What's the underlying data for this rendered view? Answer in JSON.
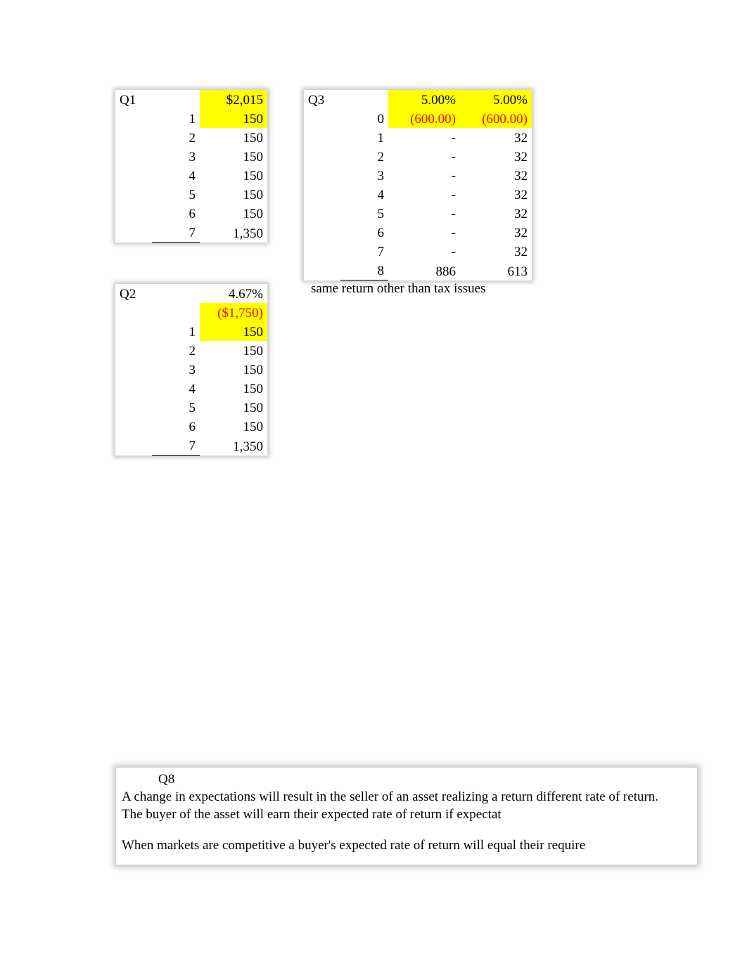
{
  "q1": {
    "label": "Q1",
    "rows": [
      {
        "idx": "",
        "val": "$2,015",
        "hl": true
      },
      {
        "idx": "1",
        "val": "150",
        "hl": true
      },
      {
        "idx": "2",
        "val": "150"
      },
      {
        "idx": "3",
        "val": "150"
      },
      {
        "idx": "4",
        "val": "150"
      },
      {
        "idx": "5",
        "val": "150"
      },
      {
        "idx": "6",
        "val": "150"
      },
      {
        "idx": "7",
        "val": "1,350",
        "underline_idx": true
      }
    ]
  },
  "q2": {
    "label": "Q2",
    "header_val": "4.67%",
    "rows": [
      {
        "idx": "",
        "val": "($1,750)",
        "hl": true,
        "neg": true
      },
      {
        "idx": "1",
        "val": "150",
        "hl": true
      },
      {
        "idx": "2",
        "val": "150"
      },
      {
        "idx": "3",
        "val": "150"
      },
      {
        "idx": "4",
        "val": "150"
      },
      {
        "idx": "5",
        "val": "150"
      },
      {
        "idx": "6",
        "val": "150"
      },
      {
        "idx": "7",
        "val": "1,350",
        "underline_idx": true
      }
    ]
  },
  "q3": {
    "label": "Q3",
    "header_a": "5.00%",
    "header_b": "5.00%",
    "rows": [
      {
        "idx": "0",
        "a": "(600.00)",
        "b": "(600.00)",
        "hl": true,
        "neg": true
      },
      {
        "idx": "1",
        "a": "-",
        "b": "32"
      },
      {
        "idx": "2",
        "a": "-",
        "b": "32"
      },
      {
        "idx": "3",
        "a": "-",
        "b": "32"
      },
      {
        "idx": "4",
        "a": "-",
        "b": "32"
      },
      {
        "idx": "5",
        "a": "-",
        "b": "32"
      },
      {
        "idx": "6",
        "a": "-",
        "b": "32"
      },
      {
        "idx": "7",
        "a": "-",
        "b": "32"
      },
      {
        "idx": "8",
        "a": "886",
        "b": "613",
        "underline_idx": true
      }
    ],
    "caption": "same return other than tax issues"
  },
  "q8": {
    "label": "Q8",
    "para1": "A change in expectations will result in the seller of an asset realizing a return different rate of return.  The buyer of the asset will earn their expected rate of return if expectat",
    "para2": "When markets are competitive a buyer's expected rate of return will equal their require"
  }
}
